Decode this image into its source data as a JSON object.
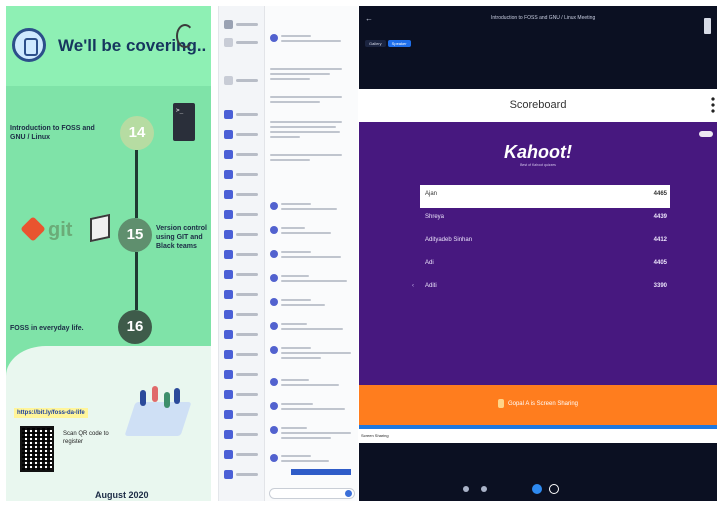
{
  "slide": {
    "title": "We'll be covering..",
    "steps": [
      {
        "number": "14",
        "text": "Introduction to FOSS and GNU / Linux"
      },
      {
        "number": "15",
        "text": "Version control using GIT and Black teams"
      },
      {
        "number": "16",
        "text": "FOSS in everyday life."
      }
    ],
    "git_word": "git",
    "link": "https://bit.ly/foss-da-life",
    "scan_text": "Scan QR code to register",
    "date": "August 2020",
    "colors": {
      "background": "#7fe3a8",
      "title": "#16365e"
    }
  },
  "zoom": {
    "title": "Introduction to FOSS and GNU / Linux Meeting",
    "tabs": [
      "Gallery",
      "Speaker"
    ],
    "scoreboard_title": "Scoreboard",
    "kahoot_logo": "Kahoot!",
    "kahoot_subtitle": "Best of Kahoot quizzes",
    "players": [
      {
        "name": "Ajan",
        "score": "4465"
      },
      {
        "name": "Shreya",
        "score": "4439"
      },
      {
        "name": "Adityadeb Sinhan",
        "score": "4412"
      },
      {
        "name": "Adi",
        "score": "4405"
      },
      {
        "name": "Aditi",
        "score": "3390"
      }
    ],
    "share_text": "Gopal A is Screen Sharing",
    "notice_text": "",
    "control_left": "Screen Sharing",
    "control_right": "",
    "colors": {
      "kahoot": "#47187f",
      "share": "#ff7d1e",
      "accent": "#1f6feb"
    }
  }
}
